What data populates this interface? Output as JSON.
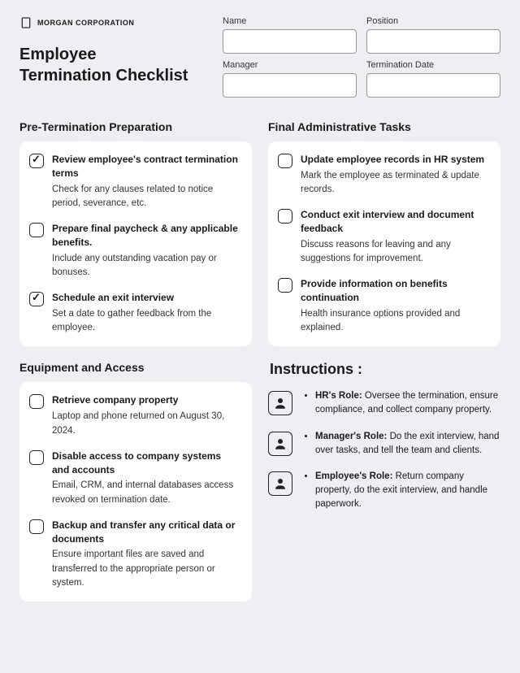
{
  "brand": "MORGAN CORPORATION",
  "title_line1": "Employee",
  "title_line2": "Termination Checklist",
  "fields": {
    "name": {
      "label": "Name",
      "value": ""
    },
    "position": {
      "label": "Position",
      "value": ""
    },
    "manager": {
      "label": "Manager",
      "value": ""
    },
    "termination_date": {
      "label": "Termination Date",
      "value": ""
    }
  },
  "sections": {
    "pre": {
      "title": "Pre-Termination Preparation",
      "items": [
        {
          "checked": true,
          "title": "Review employee's contract termination terms",
          "desc": "Check for any clauses related to notice period, severance, etc."
        },
        {
          "checked": false,
          "title": "Prepare final paycheck & any applicable benefits.",
          "desc": "Include any outstanding vacation pay or bonuses."
        },
        {
          "checked": true,
          "title": "Schedule an exit interview",
          "desc": "Set a date to gather feedback from the employee."
        }
      ]
    },
    "final": {
      "title": "Final Administrative Tasks",
      "items": [
        {
          "checked": false,
          "title": "Update employee records in HR system",
          "desc": "Mark the employee as terminated & update records."
        },
        {
          "checked": false,
          "title": "Conduct exit interview and document feedback",
          "desc": "Discuss reasons for leaving and any suggestions for improvement."
        },
        {
          "checked": false,
          "title": "Provide information on benefits continuation",
          "desc": "Health insurance options provided and explained."
        }
      ]
    },
    "equip": {
      "title": "Equipment and Access",
      "items": [
        {
          "checked": false,
          "title": "Retrieve company property",
          "desc": "Laptop and phone returned on August 30, 2024."
        },
        {
          "checked": false,
          "title": "Disable access to company systems and accounts",
          "desc": "Email, CRM, and internal databases access revoked on termination date."
        },
        {
          "checked": false,
          "title": "Backup and transfer any critical data or documents",
          "desc": "Ensure important files are saved and transferred to the appropriate person or system."
        }
      ]
    }
  },
  "instructions": {
    "title": "Instructions :",
    "rows": [
      {
        "role": "HR's Role:",
        "text": " Oversee the termination, ensure compliance, and collect company property."
      },
      {
        "role": "Manager's Role:",
        "text": " Do the exit interview, hand over tasks, and tell the team and clients."
      },
      {
        "role": "Employee's Role:",
        "text": " Return company property, do the exit interview, and handle paperwork."
      }
    ]
  }
}
